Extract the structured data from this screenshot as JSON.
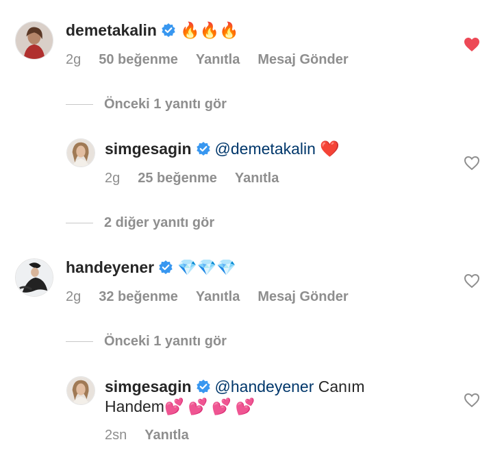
{
  "colors": {
    "text": "#262626",
    "meta": "#8e8e8e",
    "mention": "#00376b",
    "verified": "#3897f0",
    "liked_heart": "#ed4956"
  },
  "comments": [
    {
      "username": "demetakalin",
      "text": "🔥🔥🔥",
      "time": "2g",
      "likes": "50 beğenme",
      "reply": "Yanıtla",
      "message": "Mesaj Gönder",
      "heart": "heart-filled-icon",
      "view_replies": "Önceki 1 yanıtı gör"
    },
    {
      "username": "handeyener",
      "text": "💎💎💎",
      "time": "2g",
      "likes": "32 beğenme",
      "reply": "Yanıtla",
      "message": "Mesaj Gönder",
      "heart": "heart-outline-icon",
      "view_replies": "Önceki 1 yanıtı gör"
    }
  ],
  "replies": [
    {
      "username": "simgesagin",
      "mention": "@demetakalin",
      "text": "❤️",
      "time": "2g",
      "likes": "25 beğenme",
      "reply": "Yanıtla",
      "heart": "heart-outline-icon",
      "view_more": "2 diğer yanıtı gör"
    },
    {
      "username": "simgesagin",
      "mention": "@handeyener",
      "text": "Canım",
      "text_line2": "Handem",
      "emojis": "💕💕💕💕",
      "time": "2sn",
      "reply": "Yanıtla",
      "heart": "heart-outline-icon"
    }
  ]
}
